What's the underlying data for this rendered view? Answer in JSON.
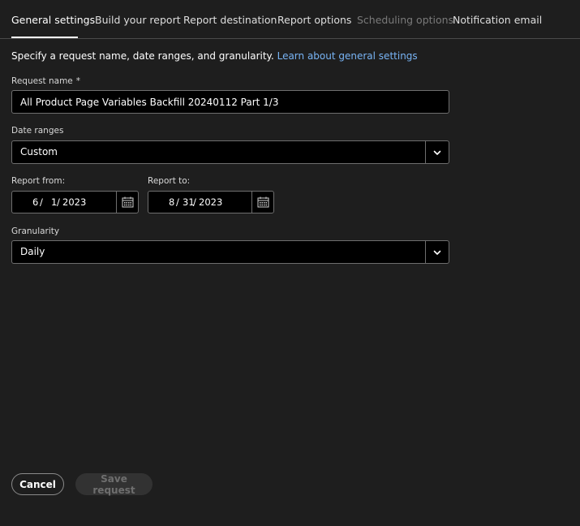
{
  "tabs": [
    {
      "label": "General settings",
      "state": "active"
    },
    {
      "label": "Build your report",
      "state": "normal"
    },
    {
      "label": "Report destination",
      "state": "normal"
    },
    {
      "label": "Report options",
      "state": "normal"
    },
    {
      "label": "Scheduling options",
      "state": "disabled"
    },
    {
      "label": "Notification email",
      "state": "normal"
    }
  ],
  "intro": {
    "text": "Specify a request name, date ranges, and granularity.",
    "link": "Learn about general settings"
  },
  "request_name": {
    "label": "Request name",
    "required_mark": "*",
    "value": "All Product Page Variables Backfill 20240112 Part 1/3"
  },
  "date_ranges": {
    "label": "Date ranges",
    "value": "Custom"
  },
  "report_from": {
    "label": "Report from:",
    "month": "6",
    "day": "1",
    "year": "2023"
  },
  "report_to": {
    "label": "Report to:",
    "month": "8",
    "day": "31",
    "year": "2023"
  },
  "granularity": {
    "label": "Granularity",
    "value": "Daily"
  },
  "footer": {
    "cancel_label": "Cancel",
    "save_label": "Save request"
  },
  "colors": {
    "background": "#1e1e1e",
    "field_background": "#000000",
    "link": "#78b4f5",
    "disabled_text": "#7a7a7a"
  },
  "icons": {
    "dropdown": "chevron-down-icon",
    "calendar": "calendar-icon"
  }
}
